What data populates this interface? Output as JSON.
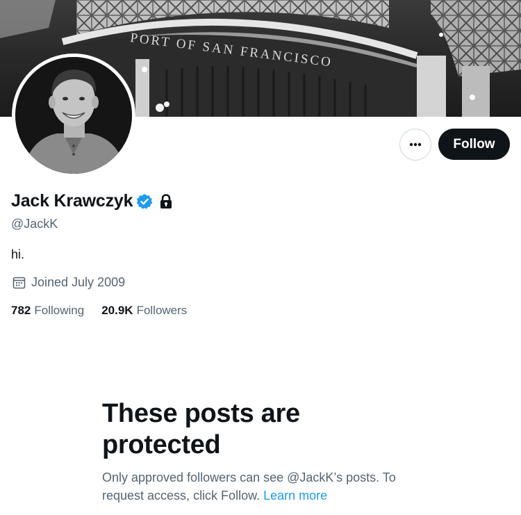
{
  "banner": {
    "sign_text": "PORT OF SAN FRANCISCO"
  },
  "profile": {
    "display_name": "Jack Krawczyk",
    "handle": "@JackK",
    "bio": "hi.",
    "joined": "Joined July 2009",
    "verified": true,
    "protected": true
  },
  "actions": {
    "more_icon": "more-horizontal-icon",
    "follow_label": "Follow"
  },
  "stats": {
    "following_count": "782",
    "following_label": "Following",
    "followers_count": "20.9K",
    "followers_label": "Followers"
  },
  "protected_notice": {
    "title": "These posts are protected",
    "body": "Only approved followers can see @JackK’s posts. To request access, click Follow. ",
    "learn_more": "Learn more"
  },
  "colors": {
    "text_primary": "#0f1419",
    "text_secondary": "#536471",
    "accent": "#1d9bf0",
    "button_dark": "#0f1419",
    "border": "#cfd9de"
  }
}
